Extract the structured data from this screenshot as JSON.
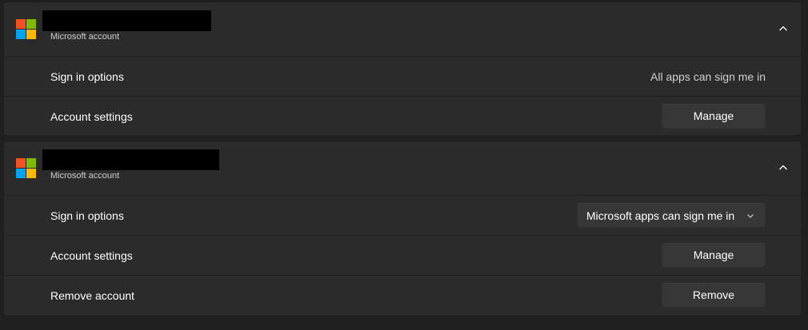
{
  "colors": {
    "ms_red": "#f25022",
    "ms_green": "#7fba00",
    "ms_blue": "#00a4ef",
    "ms_yellow": "#ffb900"
  },
  "accounts": [
    {
      "type_label": "Microsoft account",
      "rows": {
        "sign_in_label": "Sign in options",
        "sign_in_value": "All apps can sign me in",
        "settings_label": "Account settings",
        "manage_button": "Manage"
      }
    },
    {
      "type_label": "Microsoft account",
      "rows": {
        "sign_in_label": "Sign in options",
        "sign_in_dropdown": "Microsoft apps can sign me in",
        "settings_label": "Account settings",
        "manage_button": "Manage",
        "remove_label": "Remove account",
        "remove_button": "Remove"
      }
    }
  ]
}
